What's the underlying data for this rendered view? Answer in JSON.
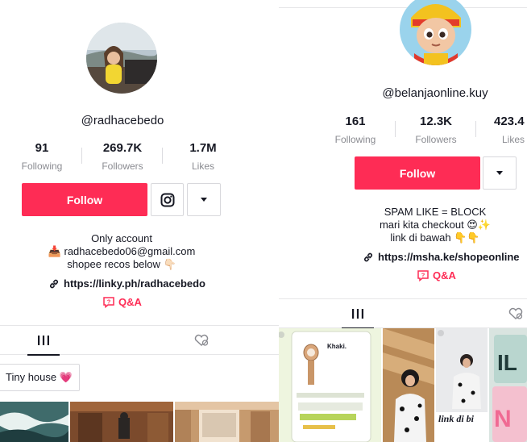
{
  "left": {
    "username": "@radhacebedo",
    "stats": [
      {
        "value": "91",
        "label": "Following"
      },
      {
        "value": "269.7K",
        "label": "Followers"
      },
      {
        "value": "1.7M",
        "label": "Likes"
      }
    ],
    "follow_label": "Follow",
    "bio": [
      "Only account",
      "📥 radhacebedo06@gmail.com",
      "shopee recos below 👇🏻"
    ],
    "link": "https://linky.ph/radhacebedo",
    "qa_label": "Q&A",
    "playlist_label": "Tiny house 💗"
  },
  "right": {
    "username": "@belanjaonline.kuy",
    "stats": [
      {
        "value": "161",
        "label": "Following"
      },
      {
        "value": "12.3K",
        "label": "Followers"
      },
      {
        "value": "423.4",
        "label": "Likes"
      }
    ],
    "follow_label": "Follow",
    "bio": [
      "SPAM LIKE = BLOCK",
      "mari kita checkout 😍✨",
      "link di bawah 👇👇"
    ],
    "link": "https://msha.ke/shopeonline",
    "qa_label": "Q&A",
    "thumb_product_name": "Khaki.",
    "thumb_caption": "link di bi"
  },
  "colors": {
    "accent": "#fe2c55",
    "text": "#161823",
    "muted": "#8a8b91"
  }
}
